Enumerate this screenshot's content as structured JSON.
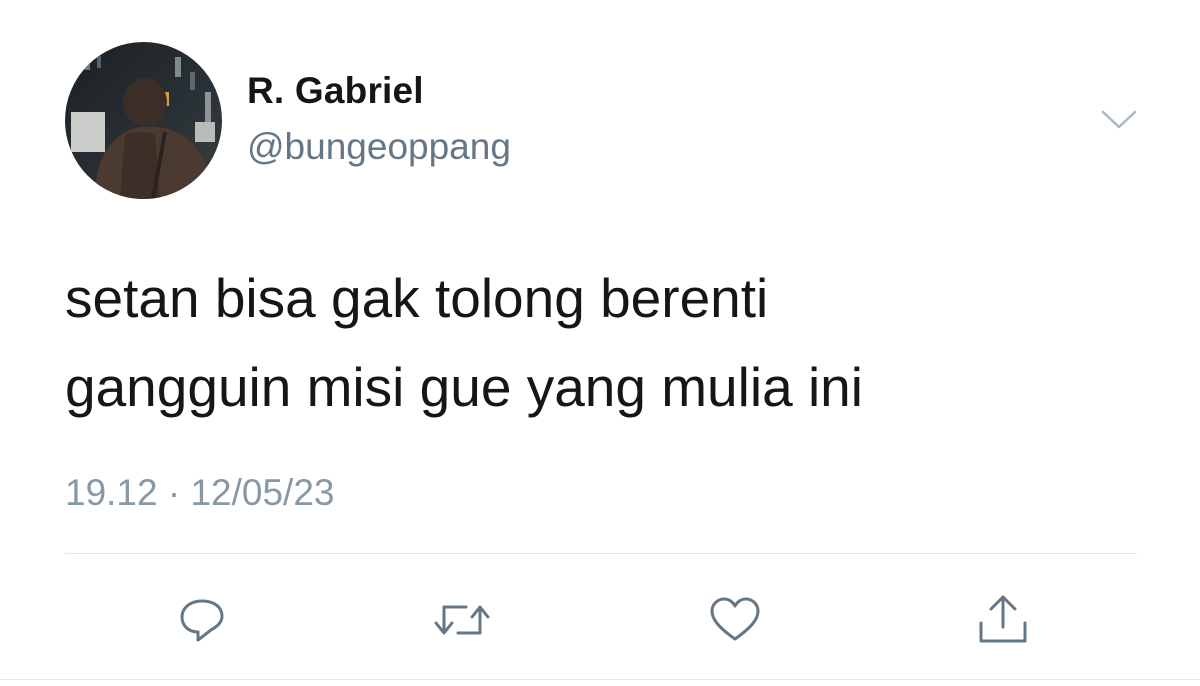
{
  "author": {
    "display_name": "R. Gabriel",
    "handle": "@bungeoppang"
  },
  "tweet": {
    "text": "setan bisa gak tolong berenti\ngangguin misi gue yang mulia ini",
    "timestamp": "19.12 · 12/05/23"
  },
  "actions": [
    {
      "name": "reply",
      "icon": "reply-icon"
    },
    {
      "name": "retweet",
      "icon": "retweet-icon"
    },
    {
      "name": "like",
      "icon": "heart-icon"
    },
    {
      "name": "share",
      "icon": "share-icon"
    }
  ],
  "colors": {
    "icon_gray": "#657786",
    "secondary_text": "#657786",
    "timestamp_text": "#8899a6",
    "divider": "#e1e8ed"
  }
}
